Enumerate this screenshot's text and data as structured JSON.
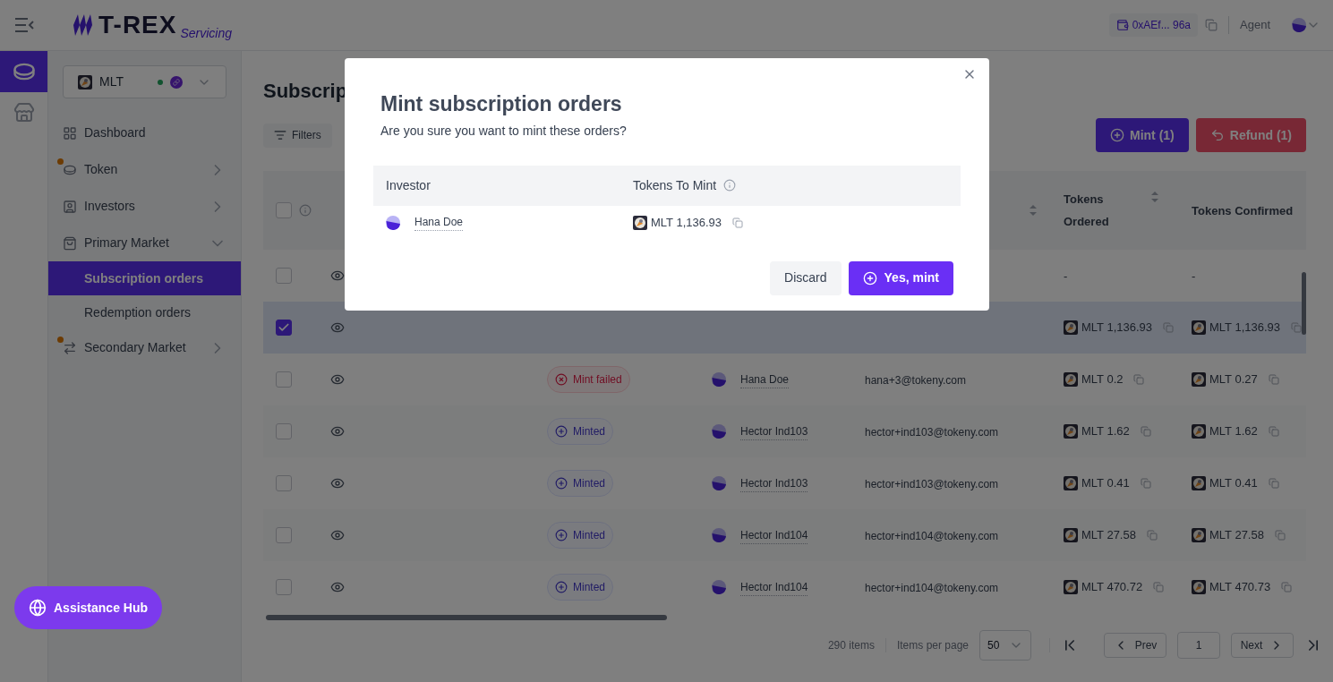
{
  "header": {
    "logo_text": "T-REX",
    "logo_sub": "Servicing",
    "wallet": "0xAEf... 96a",
    "role": "Agent"
  },
  "rail": [
    {
      "selected": true
    },
    {
      "selected": false
    }
  ],
  "token_selector": {
    "symbol": "MLT",
    "online": true
  },
  "nav": [
    {
      "label": "Dashboard",
      "kind": "link",
      "alert": false,
      "selected": false
    },
    {
      "label": "Token",
      "kind": "group",
      "alert": true,
      "expanded": false
    },
    {
      "label": "Investors",
      "kind": "group",
      "alert": false,
      "expanded": false
    },
    {
      "label": "Primary Market",
      "kind": "group",
      "alert": false,
      "expanded": true,
      "children": [
        {
          "label": "Subscription orders",
          "selected": true
        },
        {
          "label": "Redemption orders",
          "selected": false
        }
      ]
    },
    {
      "label": "Secondary Market",
      "kind": "group",
      "alert": true,
      "expanded": false
    }
  ],
  "page": {
    "title": "Subscrip",
    "filters": "Filters",
    "actions": [
      {
        "label": "Mint (1)",
        "kind": "mint"
      },
      {
        "label": "Refund (1)",
        "kind": "refund"
      }
    ]
  },
  "table": {
    "select_all_checked": false,
    "columns": [
      "Tokens Ordered",
      "Tokens Confirmed"
    ],
    "rows": [
      {
        "selected": false,
        "tokens_ordered": "-",
        "tokens_confirmed": "-"
      },
      {
        "selected": true,
        "tokens_ordered": "MLT 1,136.93",
        "tokens_confirmed": "MLT 1,136.93"
      },
      {
        "selected": false,
        "status": {
          "label": "Mint failed",
          "kind": "failed"
        },
        "investor": "Hana Doe",
        "email": "hana+3@tokeny.com",
        "tokens_ordered": "MLT 0.2",
        "tokens_confirmed": "MLT 0.27"
      },
      {
        "selected": false,
        "status": {
          "label": "Minted",
          "kind": "minted"
        },
        "investor": "Hector Ind103",
        "email": "hector+ind103@tokeny.com",
        "tokens_ordered": "MLT 1.62",
        "tokens_confirmed": "MLT 1.62"
      },
      {
        "selected": false,
        "status": {
          "label": "Minted",
          "kind": "minted"
        },
        "investor": "Hector Ind103",
        "email": "hector+ind103@tokeny.com",
        "tokens_ordered": "MLT 0.41",
        "tokens_confirmed": "MLT 0.41"
      },
      {
        "selected": false,
        "status": {
          "label": "Minted",
          "kind": "minted"
        },
        "investor": "Hector Ind104",
        "email": "hector+ind104@tokeny.com",
        "tokens_ordered": "MLT 27.58",
        "tokens_confirmed": "MLT 27.58"
      },
      {
        "selected": false,
        "status": {
          "label": "Minted",
          "kind": "minted"
        },
        "investor": "Hector Ind104",
        "email": "hector+ind104@tokeny.com",
        "tokens_ordered": "MLT 470.72",
        "tokens_confirmed": "MLT 470.73"
      }
    ]
  },
  "pagination": {
    "total": "290 items",
    "per_page_label": "Items per page",
    "per_page": "50",
    "prev": "Prev",
    "page": "1",
    "next": "Next"
  },
  "modal": {
    "title": "Mint subscription orders",
    "message": "Are you sure you want to mint these orders?",
    "columns": [
      "Investor",
      "Tokens To Mint"
    ],
    "rows": [
      {
        "investor": "Hana Doe",
        "tokens": "MLT 1,136.93"
      }
    ],
    "buttons": [
      {
        "label": "Discard",
        "kind": "secondary"
      },
      {
        "label": "Yes, mint",
        "kind": "primary"
      }
    ]
  },
  "assistance": {
    "label": "Assistance Hub"
  }
}
